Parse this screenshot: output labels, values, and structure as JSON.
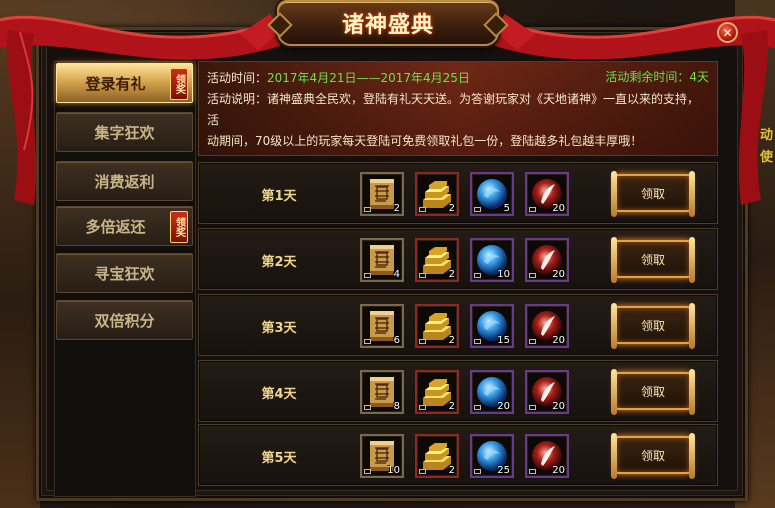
{
  "window": {
    "title": "诸神盛典",
    "close_icon": "close-icon"
  },
  "sidebar": {
    "tabs": [
      {
        "label": "登录有礼",
        "badge": "领奖",
        "active": true
      },
      {
        "label": "集字狂欢",
        "badge": "",
        "active": false
      },
      {
        "label": "消费返利",
        "badge": "",
        "active": false
      },
      {
        "label": "多倍返还",
        "badge": "领奖",
        "active": false
      },
      {
        "label": "寻宝狂欢",
        "badge": "",
        "active": false
      },
      {
        "label": "双倍积分",
        "badge": "",
        "active": false
      }
    ]
  },
  "banner": {
    "time_label": "活动时间：",
    "time_value": "2017年4月21日——2017年4月25日",
    "remain": "活动剩余时间：4天",
    "desc_line1": "活动说明：诸神盛典全民欢，登陆有礼天天送。为答谢玩家对《天地诸神》一直以来的支持，活",
    "desc_line2": "动期间，70级以上的玩家每天登陆可免费领取礼包一份，登陆越多礼包越丰厚哦！"
  },
  "item_icons": [
    "scroll-icon",
    "gold-ingot-icon",
    "blue-orb-icon",
    "red-feather-orb-icon"
  ],
  "rows": [
    {
      "day": "第1天",
      "counts": [
        "2",
        "2",
        "5",
        "20"
      ],
      "claim": "领取"
    },
    {
      "day": "第2天",
      "counts": [
        "4",
        "2",
        "10",
        "20"
      ],
      "claim": "领取"
    },
    {
      "day": "第3天",
      "counts": [
        "6",
        "2",
        "15",
        "20"
      ],
      "claim": "领取"
    },
    {
      "day": "第4天",
      "counts": [
        "8",
        "2",
        "20",
        "20"
      ],
      "claim": "领取"
    },
    {
      "day": "第5天",
      "counts": [
        "10",
        "2",
        "25",
        "20"
      ],
      "claim": "领取"
    }
  ],
  "side_text": {
    "line1": "动",
    "line2": "使"
  },
  "colors": {
    "accent_gold": "#d6a650",
    "time_green": "#6ee04a",
    "ribbon_red": "#b0141a",
    "claim_glow": "#ff8a20"
  }
}
